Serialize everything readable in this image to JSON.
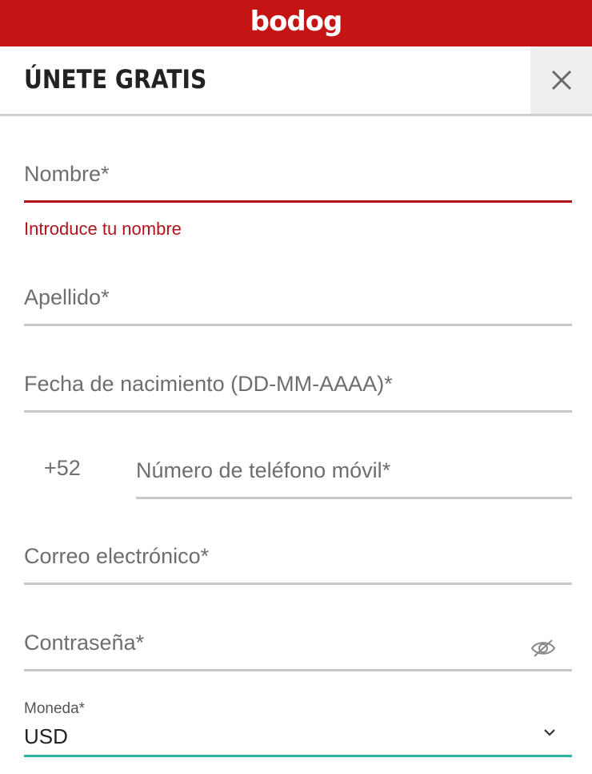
{
  "brand": {
    "logo_text": "bodog",
    "color": "#c41414"
  },
  "header": {
    "title": "ÚNETE GRATIS",
    "close_icon": "close-icon"
  },
  "form": {
    "first_name": {
      "placeholder": "Nombre*",
      "error": "Introduce tu nombre"
    },
    "last_name": {
      "placeholder": "Apellido*"
    },
    "birth_date": {
      "placeholder": "Fecha de nacimiento (DD-MM-AAAA)*"
    },
    "phone": {
      "prefix": "+52",
      "placeholder": "Número de teléfono móvil*"
    },
    "email": {
      "placeholder": "Correo electrónico*"
    },
    "password": {
      "placeholder": "Contraseña*",
      "toggle_icon": "eye-off-icon"
    },
    "currency": {
      "label": "Moneda*",
      "value": "USD",
      "dropdown_icon": "chevron-down-icon"
    }
  },
  "colors": {
    "error": "#b0141c",
    "active_underline": "#2bb3a3",
    "underline": "#c8c8c8"
  }
}
